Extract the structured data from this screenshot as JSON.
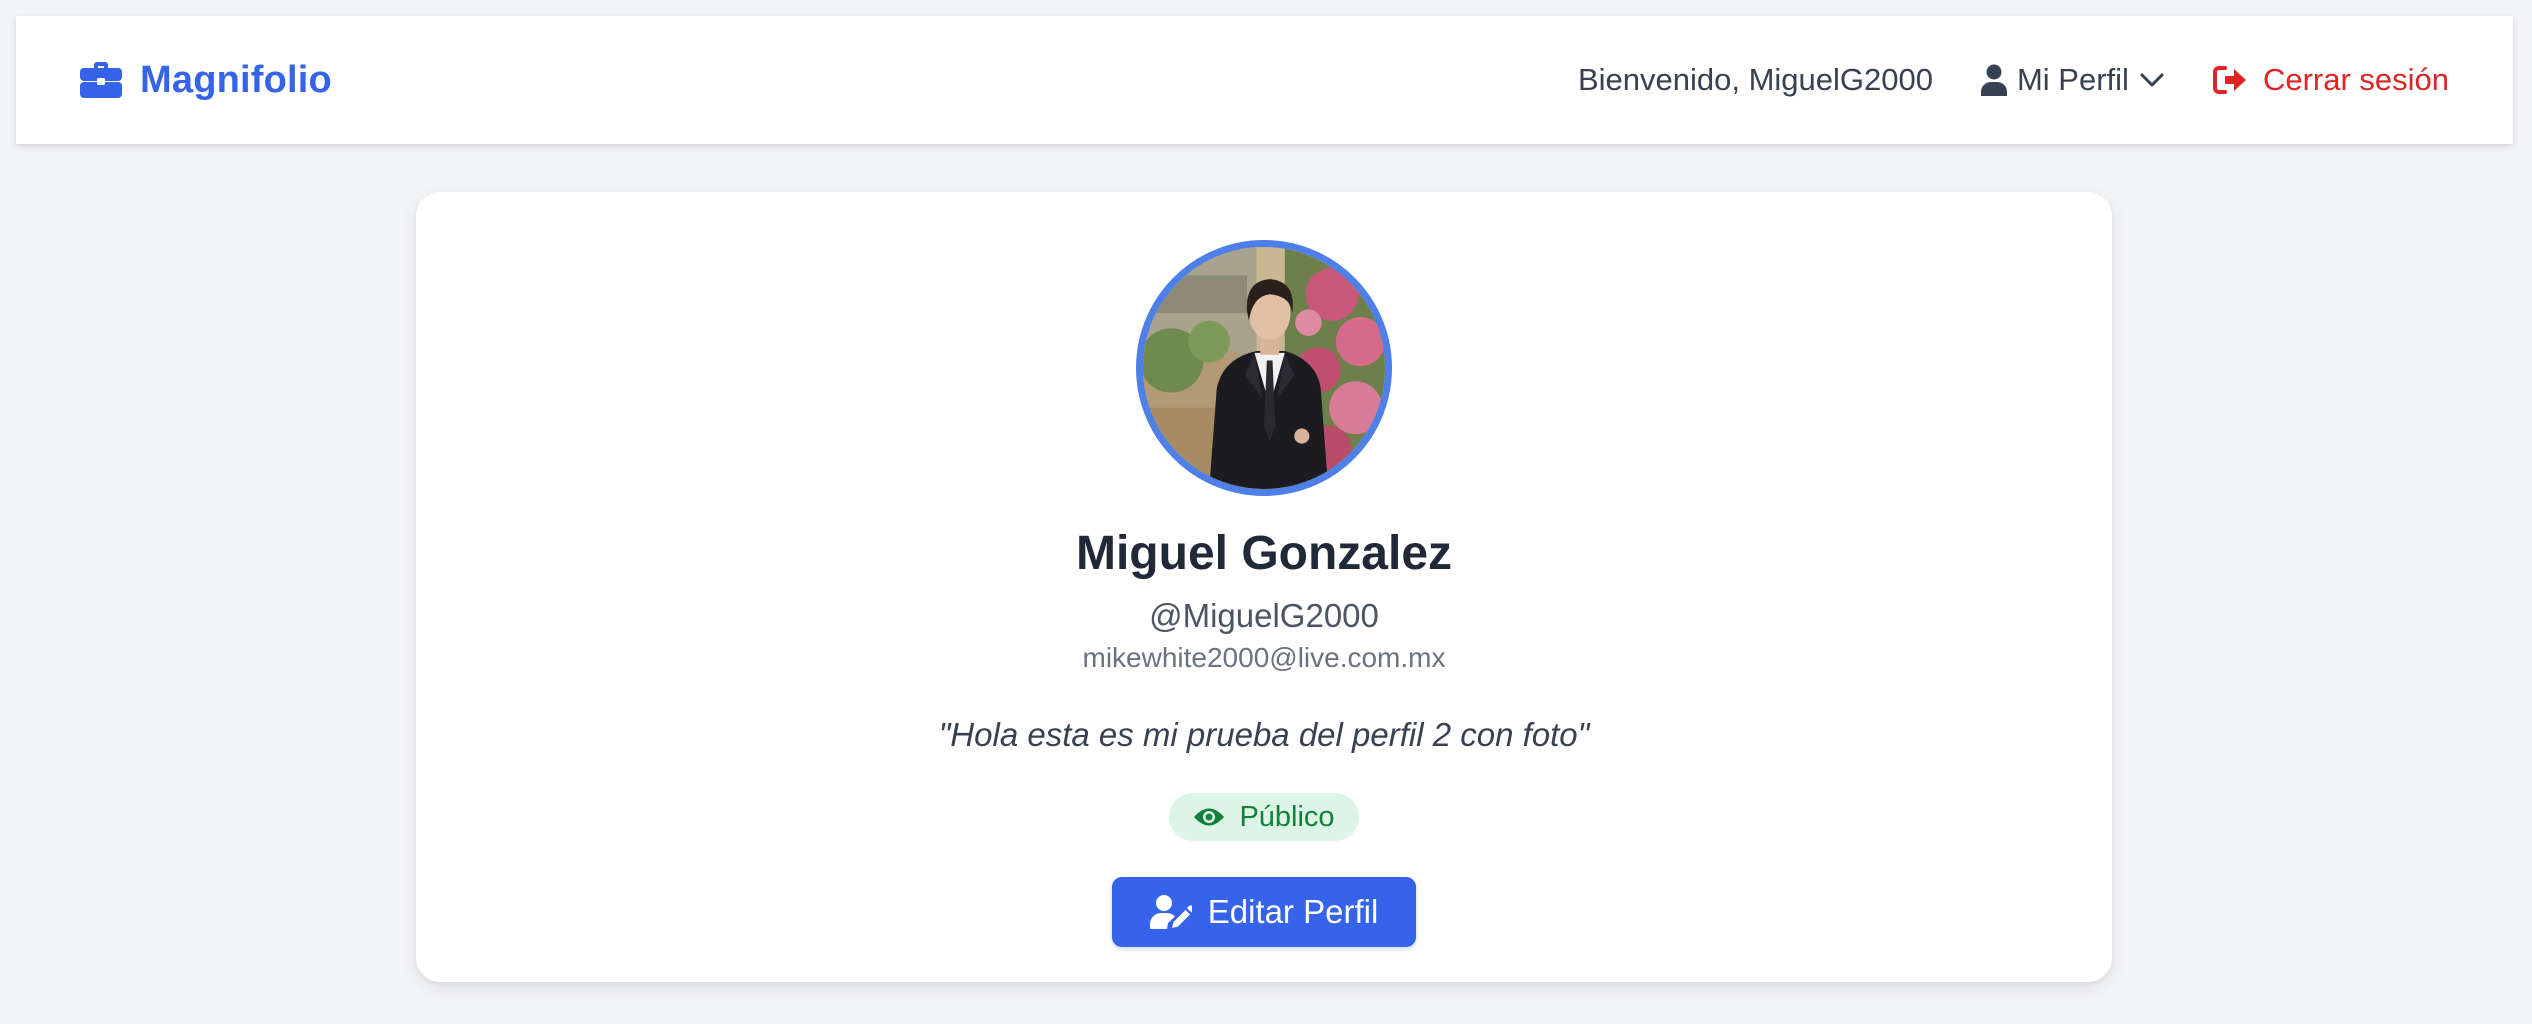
{
  "navbar": {
    "brand_icon": "briefcase-icon",
    "brand_name": "Magnifolio",
    "welcome_text": "Bienvenido, MiguelG2000",
    "profile_menu": {
      "icon": "user-icon",
      "label": "Mi Perfil",
      "chevron_icon": "chevron-down-icon"
    },
    "logout": {
      "icon": "sign-out-icon",
      "label": "Cerrar sesión"
    }
  },
  "profile": {
    "avatar": "profile-photo",
    "full_name": "Miguel Gonzalez",
    "username": "@MiguelG2000",
    "email": "mikewhite2000@live.com.mx",
    "bio": "\"Hola esta es mi prueba del perfil 2 con foto\"",
    "visibility": {
      "icon": "eye-icon",
      "label": "Público"
    },
    "edit_button": {
      "icon": "user-pen-icon",
      "label": "Editar Perfil"
    }
  },
  "colors": {
    "primary": "#3563e9",
    "danger": "#dc2626",
    "success_bg": "#dcf5e6",
    "success_text": "#15803d",
    "page_bg": "#f3f4f6",
    "avatar_ring": "#4f7fe8"
  }
}
